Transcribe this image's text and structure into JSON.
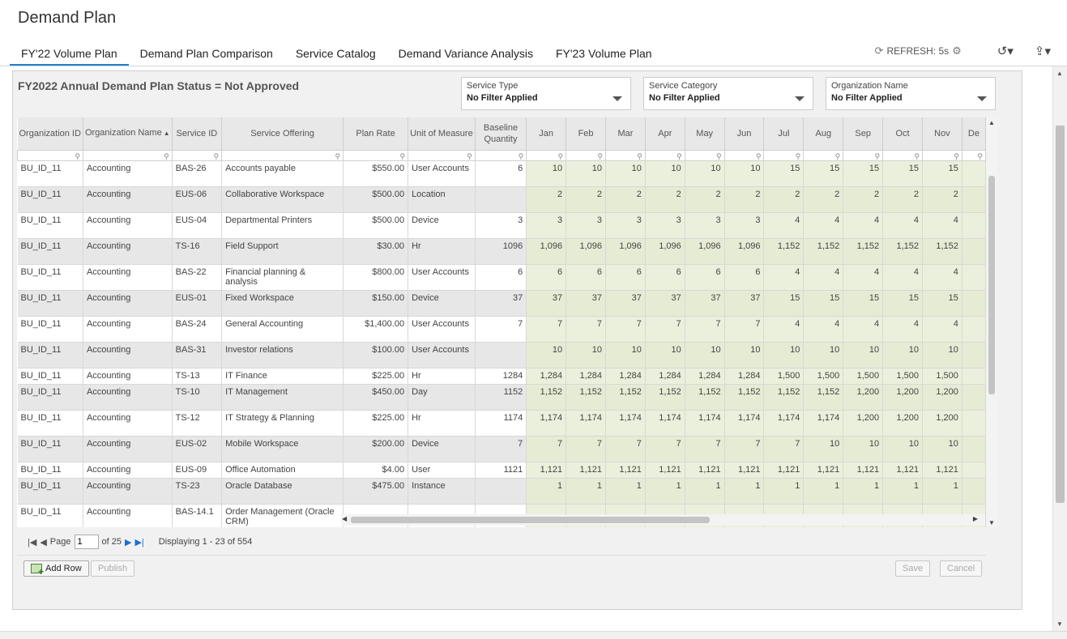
{
  "page": {
    "title": "Demand Plan"
  },
  "tabs": [
    "FY'22 Volume Plan",
    "Demand Plan Comparison",
    "Service Catalog",
    "Demand Variance Analysis",
    "FY'23 Volume Plan"
  ],
  "toolbar": {
    "refresh_label": "REFRESH: 5s"
  },
  "status": {
    "text": "FY2022 Annual Demand Plan Status = Not Approved"
  },
  "filters": [
    {
      "label": "Service Type",
      "value": "No Filter Applied"
    },
    {
      "label": "Service Category",
      "value": "No Filter Applied"
    },
    {
      "label": "Organization Name",
      "value": "No Filter Applied"
    }
  ],
  "grid": {
    "columns": [
      "Organization ID",
      "Organization Name",
      "Service ID",
      "Service Offering",
      "Plan Rate",
      "Unit of Measure",
      "Baseline Quantity",
      "Jan",
      "Feb",
      "Mar",
      "Apr",
      "May",
      "Jun",
      "Jul",
      "Aug",
      "Sep",
      "Oct",
      "Nov",
      "De"
    ],
    "sort_column": "Organization Name",
    "rows": [
      [
        "BU_ID_11",
        "Accounting",
        "BAS-26",
        "Accounts payable",
        "$550.00",
        "User Accounts",
        "6",
        "10",
        "10",
        "10",
        "10",
        "10",
        "10",
        "15",
        "15",
        "15",
        "15",
        "15",
        ""
      ],
      [
        "BU_ID_11",
        "Accounting",
        "EUS-06",
        "Collaborative Workspace",
        "$500.00",
        "Location",
        "",
        "2",
        "2",
        "2",
        "2",
        "2",
        "2",
        "2",
        "2",
        "2",
        "2",
        "2",
        ""
      ],
      [
        "BU_ID_11",
        "Accounting",
        "EUS-04",
        "Departmental Printers",
        "$500.00",
        "Device",
        "3",
        "3",
        "3",
        "3",
        "3",
        "3",
        "3",
        "4",
        "4",
        "4",
        "4",
        "4",
        ""
      ],
      [
        "BU_ID_11",
        "Accounting",
        "TS-16",
        "Field Support",
        "$30.00",
        "Hr",
        "1096",
        "1,096",
        "1,096",
        "1,096",
        "1,096",
        "1,096",
        "1,096",
        "1,152",
        "1,152",
        "1,152",
        "1,152",
        "1,152",
        ""
      ],
      [
        "BU_ID_11",
        "Accounting",
        "BAS-22",
        "Financial planning & analysis",
        "$800.00",
        "User Accounts",
        "6",
        "6",
        "6",
        "6",
        "6",
        "6",
        "6",
        "4",
        "4",
        "4",
        "4",
        "4",
        ""
      ],
      [
        "BU_ID_11",
        "Accounting",
        "EUS-01",
        "Fixed Workspace",
        "$150.00",
        "Device",
        "37",
        "37",
        "37",
        "37",
        "37",
        "37",
        "37",
        "15",
        "15",
        "15",
        "15",
        "15",
        ""
      ],
      [
        "BU_ID_11",
        "Accounting",
        "BAS-24",
        "General Accounting",
        "$1,400.00",
        "User Accounts",
        "7",
        "7",
        "7",
        "7",
        "7",
        "7",
        "7",
        "4",
        "4",
        "4",
        "4",
        "4",
        ""
      ],
      [
        "BU_ID_11",
        "Accounting",
        "BAS-31",
        "Investor relations",
        "$100.00",
        "User Accounts",
        "",
        "10",
        "10",
        "10",
        "10",
        "10",
        "10",
        "10",
        "10",
        "10",
        "10",
        "10",
        ""
      ],
      [
        "BU_ID_11",
        "Accounting",
        "TS-13",
        "IT Finance",
        "$225.00",
        "Hr",
        "1284",
        "1,284",
        "1,284",
        "1,284",
        "1,284",
        "1,284",
        "1,284",
        "1,500",
        "1,500",
        "1,500",
        "1,500",
        "1,500",
        ""
      ],
      [
        "BU_ID_11",
        "Accounting",
        "TS-10",
        "IT Management",
        "$450.00",
        "Day",
        "1152",
        "1,152",
        "1,152",
        "1,152",
        "1,152",
        "1,152",
        "1,152",
        "1,152",
        "1,152",
        "1,200",
        "1,200",
        "1,200",
        ""
      ],
      [
        "BU_ID_11",
        "Accounting",
        "TS-12",
        "IT Strategy & Planning",
        "$225.00",
        "Hr",
        "1174",
        "1,174",
        "1,174",
        "1,174",
        "1,174",
        "1,174",
        "1,174",
        "1,174",
        "1,174",
        "1,200",
        "1,200",
        "1,200",
        ""
      ],
      [
        "BU_ID_11",
        "Accounting",
        "EUS-02",
        "Mobile Workspace",
        "$200.00",
        "Device",
        "7",
        "7",
        "7",
        "7",
        "7",
        "7",
        "7",
        "7",
        "10",
        "10",
        "10",
        "10",
        ""
      ],
      [
        "BU_ID_11",
        "Accounting",
        "EUS-09",
        "Office Automation",
        "$4.00",
        "User",
        "1121",
        "1,121",
        "1,121",
        "1,121",
        "1,121",
        "1,121",
        "1,121",
        "1,121",
        "1,121",
        "1,121",
        "1,121",
        "1,121",
        ""
      ],
      [
        "BU_ID_11",
        "Accounting",
        "TS-23",
        "Oracle Database",
        "$475.00",
        "Instance",
        "",
        "1",
        "1",
        "1",
        "1",
        "1",
        "1",
        "1",
        "1",
        "1",
        "1",
        "1",
        ""
      ],
      [
        "BU_ID_11",
        "Accounting",
        "BAS-14.1",
        "Order Management (Oracle CRM)",
        "",
        "",
        "",
        "",
        "",
        "",
        "",
        "",
        "",
        "",
        "",
        "",
        "",
        "",
        ""
      ]
    ]
  },
  "pager": {
    "page_label": "Page",
    "page_value": "1",
    "of_label": "of 25",
    "display_text": "Displaying 1 - 23 of 554"
  },
  "buttons": {
    "add_row": "Add Row",
    "publish": "Publish",
    "save": "Save",
    "cancel": "Cancel"
  }
}
